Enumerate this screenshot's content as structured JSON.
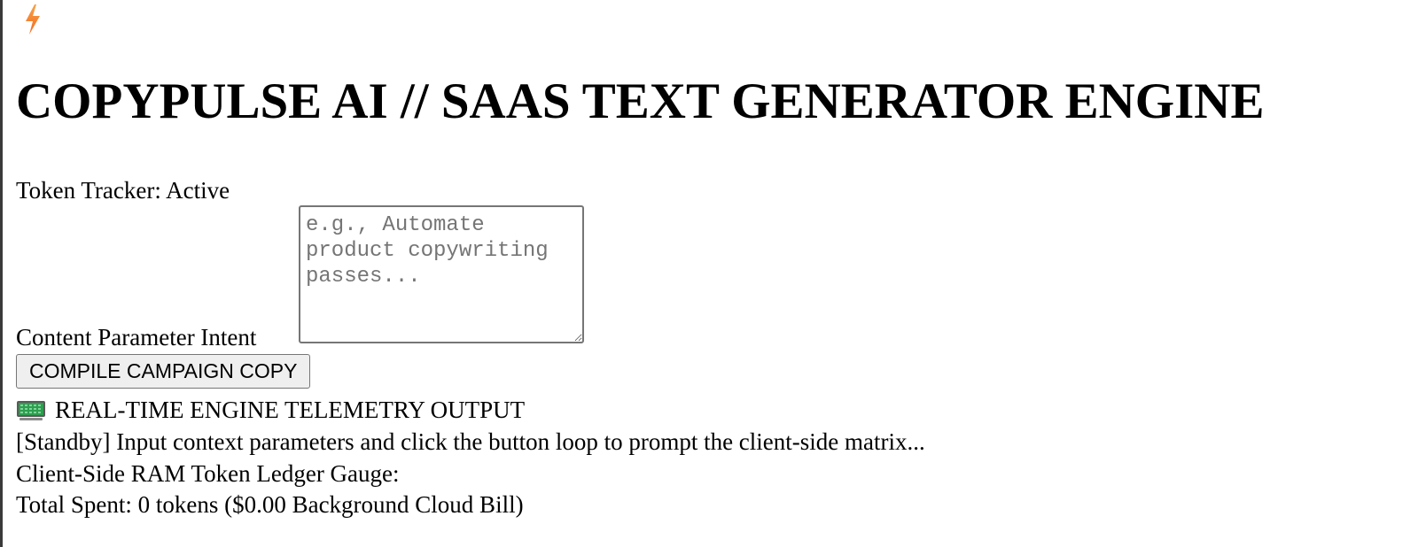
{
  "header": {
    "logo_icon": "lightning-bolt-icon",
    "title": "COPYPULSE AI // SAAS TEXT GENERATOR ENGINE"
  },
  "status": {
    "token_tracker": "Token Tracker: Active"
  },
  "form": {
    "intent_label": "Content Parameter Intent",
    "intent_value": "",
    "intent_placeholder": "e.g., Automate product copywriting passes...",
    "compile_button_label": "COMPILE CAMPAIGN COPY"
  },
  "telemetry": {
    "icon": "monitor-icon",
    "heading": "REAL-TIME ENGINE TELEMETRY OUTPUT",
    "output": "[Standby] Input context parameters and click the button loop to prompt the client-side matrix..."
  },
  "ledger": {
    "gauge_label": "Client-Side RAM Token Ledger Gauge:",
    "total_spent": "Total Spent: 0 tokens ($0.00 Background Cloud Bill)"
  },
  "colors": {
    "bolt": "#f26b1d",
    "bolt_light": "#f7a24a",
    "monitor_screen": "#2e9e4f",
    "monitor_frame": "#5a5a5a",
    "button_bg": "#efefef",
    "border": "#767676"
  }
}
